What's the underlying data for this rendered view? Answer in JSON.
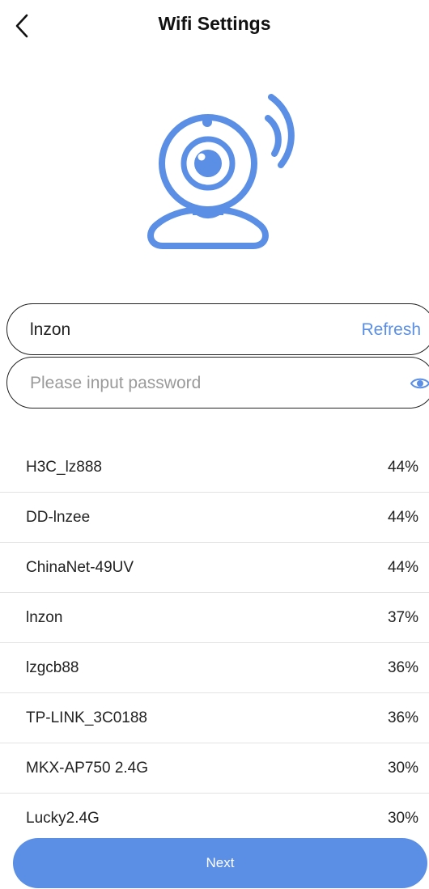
{
  "header": {
    "title": "Wifi Settings"
  },
  "wifi_field": {
    "ssid": "lnzon",
    "refresh_label": "Refresh"
  },
  "password_field": {
    "value": "",
    "placeholder": "Please input password"
  },
  "networks": [
    {
      "name": "H3C_lz888",
      "strength": "44%"
    },
    {
      "name": "DD-lnzee",
      "strength": "44%"
    },
    {
      "name": "ChinaNet-49UV",
      "strength": "44%"
    },
    {
      "name": "lnzon",
      "strength": "37%"
    },
    {
      "name": "lzgcb88",
      "strength": "36%"
    },
    {
      "name": "TP-LINK_3C0188",
      "strength": "36%"
    },
    {
      "name": "MKX-AP750 2.4G",
      "strength": "30%"
    },
    {
      "name": "Lucky2.4G",
      "strength": "30%"
    }
  ],
  "next_label": "Next",
  "icons": {
    "back": "back-chevron-icon",
    "hero": "webcam-wifi-icon",
    "eye": "eye-icon"
  },
  "colors": {
    "accent": "#5b8fe6",
    "text": "#222222",
    "placeholder": "#9a9a9a",
    "divider": "#e3e3e3"
  }
}
